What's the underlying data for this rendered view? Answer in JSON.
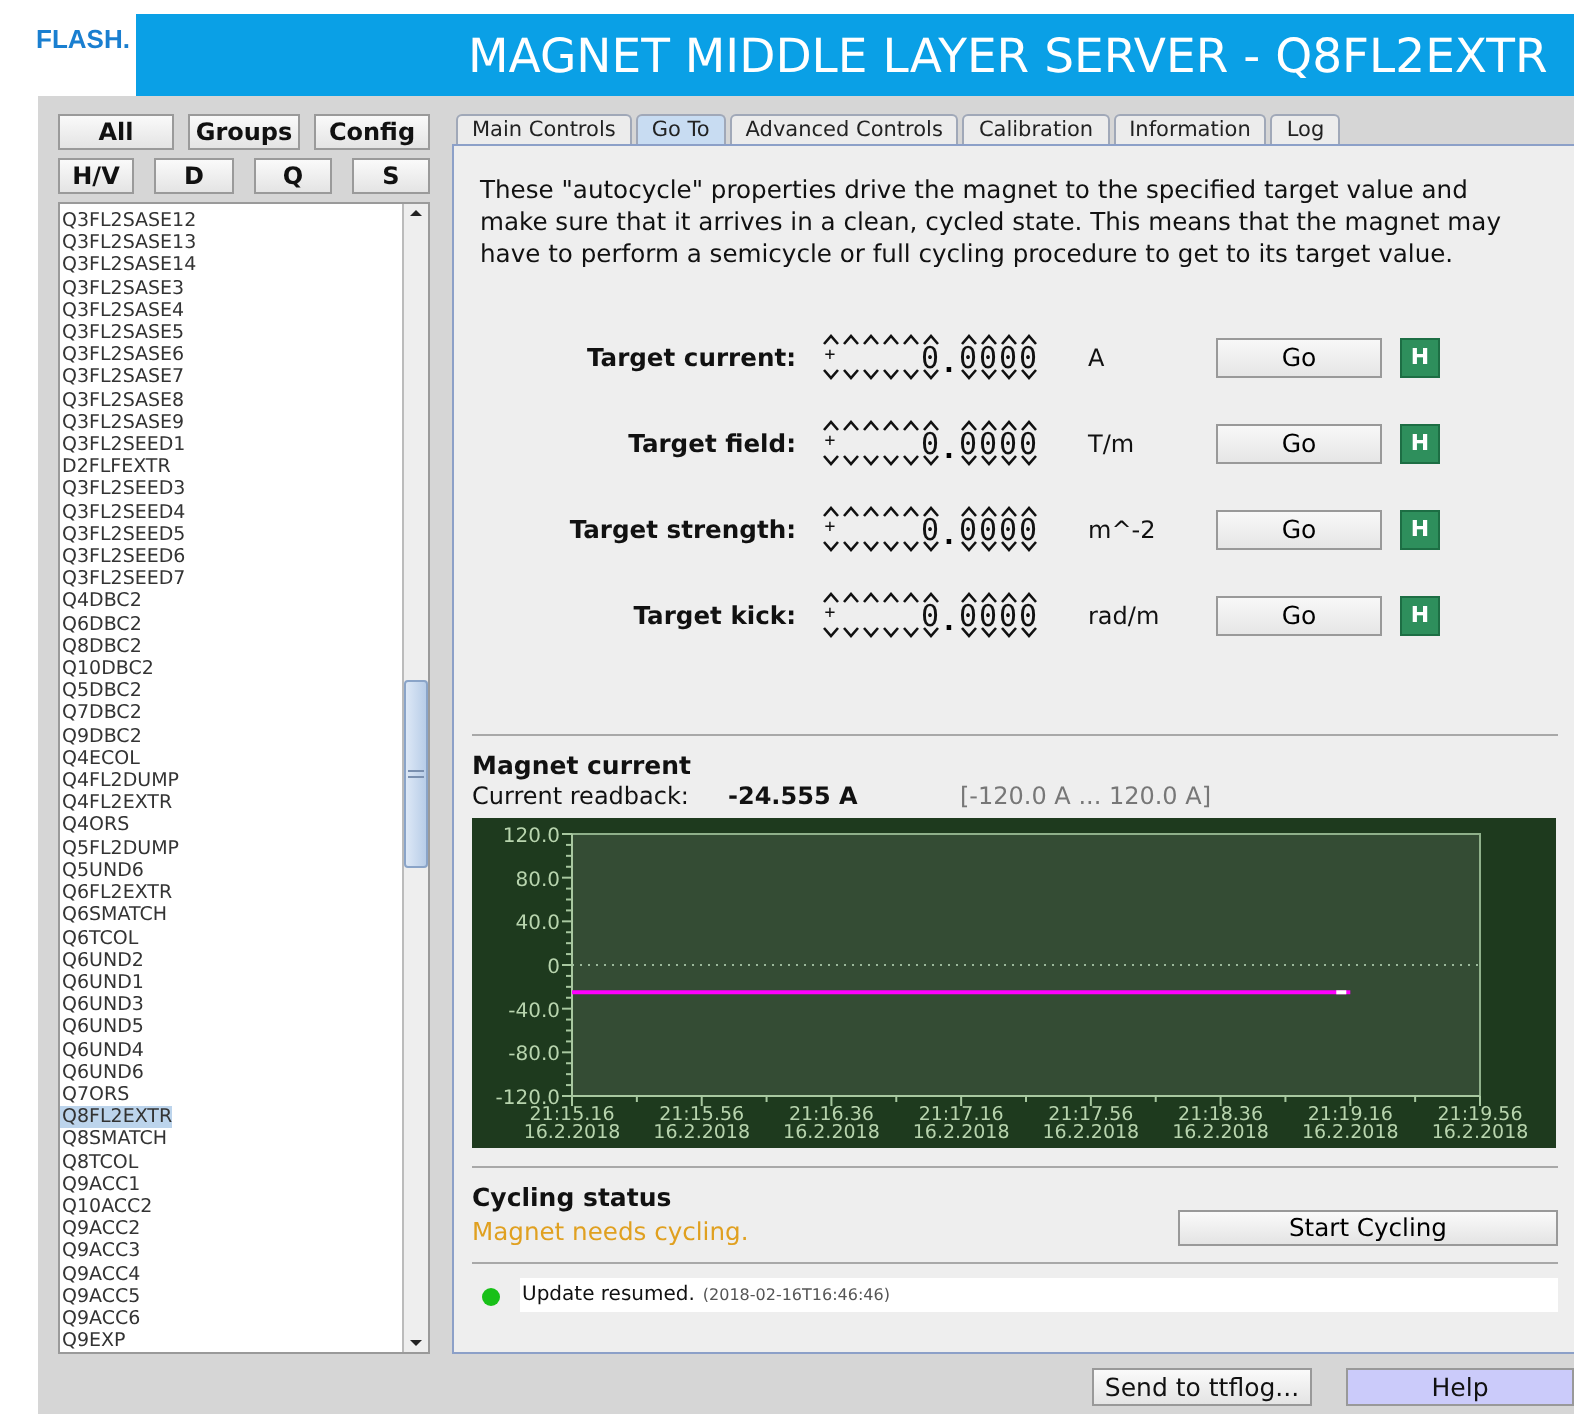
{
  "logo": "FLASH.",
  "window": {
    "title": "MAGNET MIDDLE LAYER SERVER - Q8FL2EXTR"
  },
  "filter_buttons": [
    [
      "All",
      "Groups",
      "Config"
    ],
    [
      "H/V",
      "D",
      "Q",
      "S"
    ]
  ],
  "magnet_list": [
    {
      "label": "Q3FL2SASE12",
      "selected": false
    },
    {
      "label": "Q3FL2SASE13",
      "selected": false
    },
    {
      "label": "Q3FL2SASE14",
      "selected": false
    },
    {
      "label": "Q3FL2SASE3",
      "selected": false
    },
    {
      "label": "Q3FL2SASE4",
      "selected": false
    },
    {
      "label": "Q3FL2SASE5",
      "selected": false
    },
    {
      "label": "Q3FL2SASE6",
      "selected": false
    },
    {
      "label": "Q3FL2SASE7",
      "selected": false
    },
    {
      "label": "Q3FL2SASE8",
      "selected": false
    },
    {
      "label": "Q3FL2SASE9",
      "selected": false
    },
    {
      "label": "Q3FL2SEED1",
      "selected": false
    },
    {
      "label": "D2FLFEXTR",
      "selected": false
    },
    {
      "label": "Q3FL2SEED3",
      "selected": false
    },
    {
      "label": "Q3FL2SEED4",
      "selected": false
    },
    {
      "label": "Q3FL2SEED5",
      "selected": false
    },
    {
      "label": "Q3FL2SEED6",
      "selected": false
    },
    {
      "label": "Q3FL2SEED7",
      "selected": false
    },
    {
      "label": "Q4DBC2",
      "selected": false
    },
    {
      "label": "Q6DBC2",
      "selected": false
    },
    {
      "label": "Q8DBC2",
      "selected": false
    },
    {
      "label": "Q10DBC2",
      "selected": false
    },
    {
      "label": "Q5DBC2",
      "selected": false
    },
    {
      "label": "Q7DBC2",
      "selected": false
    },
    {
      "label": "Q9DBC2",
      "selected": false
    },
    {
      "label": "Q4ECOL",
      "selected": false
    },
    {
      "label": "Q4FL2DUMP",
      "selected": false
    },
    {
      "label": "Q4FL2EXTR",
      "selected": false
    },
    {
      "label": "Q4ORS",
      "selected": false
    },
    {
      "label": "Q5FL2DUMP",
      "selected": false
    },
    {
      "label": "Q5UND6",
      "selected": false
    },
    {
      "label": "Q6FL2EXTR",
      "selected": false
    },
    {
      "label": "Q6SMATCH",
      "selected": false
    },
    {
      "label": "Q6TCOL",
      "selected": false
    },
    {
      "label": "Q6UND2",
      "selected": false
    },
    {
      "label": "Q6UND1",
      "selected": false
    },
    {
      "label": "Q6UND3",
      "selected": false
    },
    {
      "label": "Q6UND5",
      "selected": false
    },
    {
      "label": "Q6UND4",
      "selected": false
    },
    {
      "label": "Q6UND6",
      "selected": false
    },
    {
      "label": "Q7ORS",
      "selected": false
    },
    {
      "label": "Q8FL2EXTR",
      "selected": true
    },
    {
      "label": "Q8SMATCH",
      "selected": false
    },
    {
      "label": "Q8TCOL",
      "selected": false
    },
    {
      "label": "Q9ACC1",
      "selected": false
    },
    {
      "label": "Q10ACC2",
      "selected": false
    },
    {
      "label": "Q9ACC2",
      "selected": false
    },
    {
      "label": "Q9ACC3",
      "selected": false
    },
    {
      "label": "Q9ACC4",
      "selected": false
    },
    {
      "label": "Q9ACC5",
      "selected": false
    },
    {
      "label": "Q9ACC6",
      "selected": false
    },
    {
      "label": "Q9EXP",
      "selected": false
    }
  ],
  "tabs": [
    {
      "label": "Main Controls",
      "selected": false
    },
    {
      "label": "Go To",
      "selected": true
    },
    {
      "label": "Advanced Controls",
      "selected": false
    },
    {
      "label": "Calibration",
      "selected": false
    },
    {
      "label": "Information",
      "selected": false
    },
    {
      "label": "Log",
      "selected": false
    }
  ],
  "description": "These \"autocycle\" properties drive the magnet to the specified target value and make sure that it arrives in a clean, cycled state. This means that the magnet may have to perform a semicycle or full cycling procedure to get to its target value.",
  "targets": [
    {
      "label": "Target current:",
      "sign": "+",
      "value": "0.0000",
      "unit": "A",
      "button": "Go",
      "history": "H"
    },
    {
      "label": "Target field:",
      "sign": "+",
      "value": "0.0000",
      "unit": "T/m",
      "button": "Go",
      "history": "H"
    },
    {
      "label": "Target strength:",
      "sign": "+",
      "value": "0.0000",
      "unit": "m^-2",
      "button": "Go",
      "history": "H"
    },
    {
      "label": "Target kick:",
      "sign": "+",
      "value": "0.0000",
      "unit": "rad/m",
      "button": "Go",
      "history": "H"
    }
  ],
  "magnet_current": {
    "heading": "Magnet current",
    "readback_label": "Current readback:",
    "readback": "-24.555 A",
    "range": "[-120.0 A ... 120.0 A]",
    "chart_data": {
      "type": "line",
      "categories": [
        "21:15.16 16.2.2018",
        "21:15.56 16.2.2018",
        "21:16.36 16.2.2018",
        "21:17.16 16.2.2018",
        "21:17.56 16.2.2018",
        "21:18.36 16.2.2018",
        "21:19.16 16.2.2018",
        "21:19.56 16.2.2018"
      ],
      "series": [
        {
          "color": "#ff00ff",
          "values": [
            -25,
            -25,
            -25,
            -25,
            -25,
            -25,
            -25,
            null
          ]
        }
      ],
      "ylim": [
        -120,
        120
      ],
      "yticks": [
        {
          "value": 120,
          "label": "120.0"
        },
        {
          "value": 80,
          "label": "80.0"
        },
        {
          "value": 40,
          "label": "40.0"
        },
        {
          "value": 0,
          "label": "0"
        },
        {
          "value": -40,
          "label": "-40.0"
        },
        {
          "value": -80,
          "label": "-80.0"
        },
        {
          "value": -120,
          "label": "-120.0"
        }
      ]
    }
  },
  "cycling": {
    "heading": "Cycling status",
    "message": "Magnet needs cycling.",
    "button": "Start Cycling"
  },
  "status": {
    "ok": true,
    "message": "Update resumed.",
    "timestamp": "(2018-02-16T16:46:46)"
  },
  "footer_buttons": [
    "Send to ttflog...",
    "Help"
  ]
}
